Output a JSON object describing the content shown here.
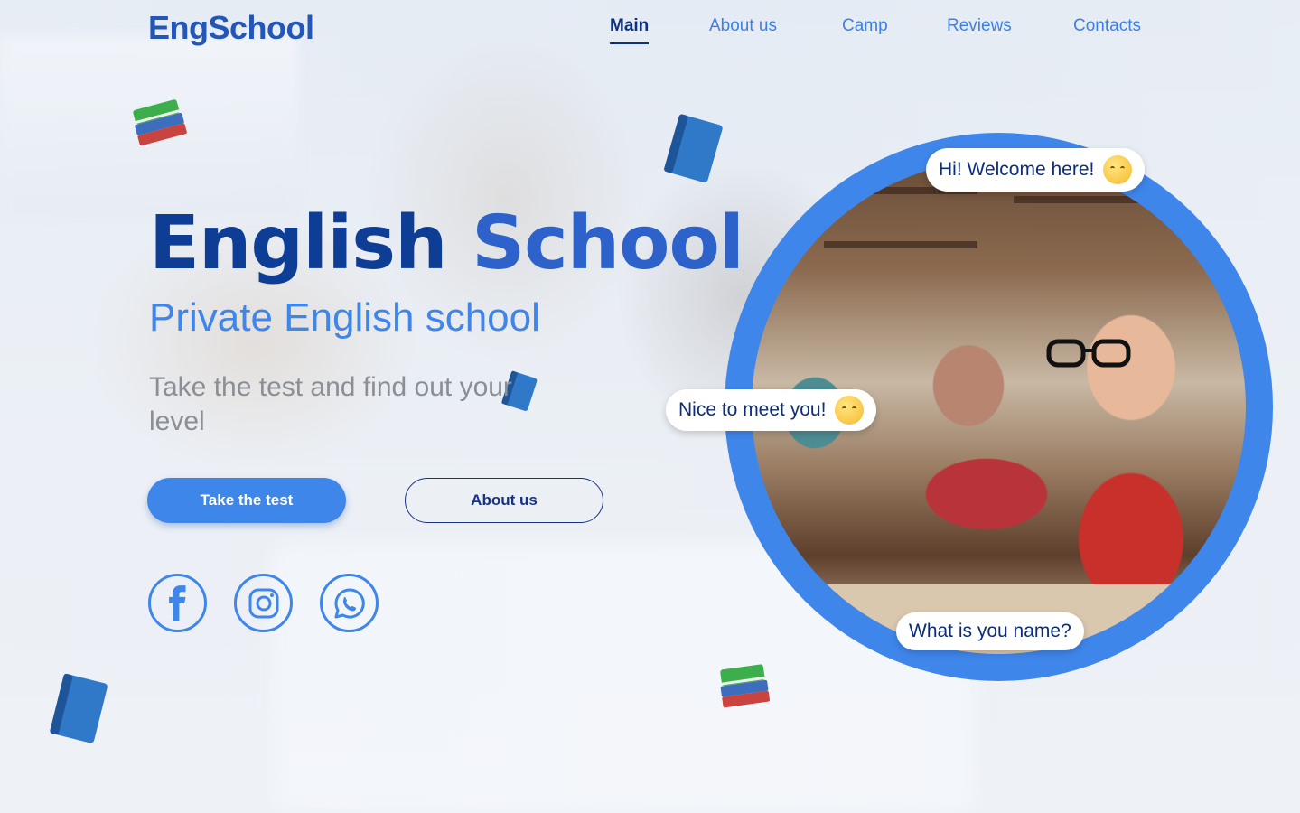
{
  "nav": {
    "logo": "EngSchool",
    "items": [
      {
        "label": "Main",
        "active": true
      },
      {
        "label": "About us",
        "active": false
      },
      {
        "label": "Camp",
        "active": false
      },
      {
        "label": "Reviews",
        "active": false
      },
      {
        "label": "Contacts",
        "active": false
      }
    ]
  },
  "hero": {
    "title_word1": "English",
    "title_word2": "School",
    "subtitle": "Private English school",
    "tagline": "Take the test and find out your level",
    "primary_button": "Take the test",
    "secondary_button": "About us"
  },
  "social": [
    "facebook-icon",
    "instagram-icon",
    "whatsapp-icon"
  ],
  "bubbles": {
    "welcome": "Hi! Welcome here!",
    "nice": "Nice to meet you!",
    "name": "What is you name?"
  },
  "colors": {
    "accent": "#3f86eb",
    "dark_blue": "#0e3d96",
    "active_nav": "#0d3282"
  }
}
